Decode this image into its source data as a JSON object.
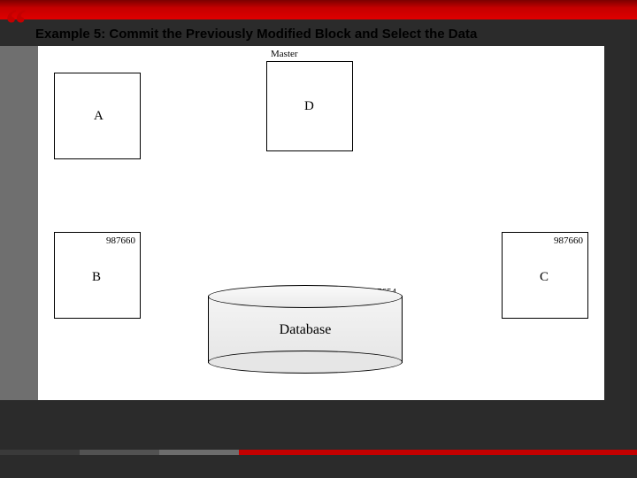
{
  "title": "Example 5: Commit the Previously Modified Block and Select the Data",
  "quote": "“",
  "master_label": "Master",
  "boxes": {
    "A": {
      "label": "A",
      "value": ""
    },
    "B": {
      "label": "B",
      "value": "987660"
    },
    "C": {
      "label": "C",
      "value": "987660"
    },
    "D": {
      "label": "D",
      "value": ""
    }
  },
  "database": {
    "label": "Database",
    "value": "987654"
  },
  "colors": {
    "accent_red": "#c40000",
    "dark_bg": "#2b2b2b",
    "grey_strip": "#6f6f6f"
  }
}
